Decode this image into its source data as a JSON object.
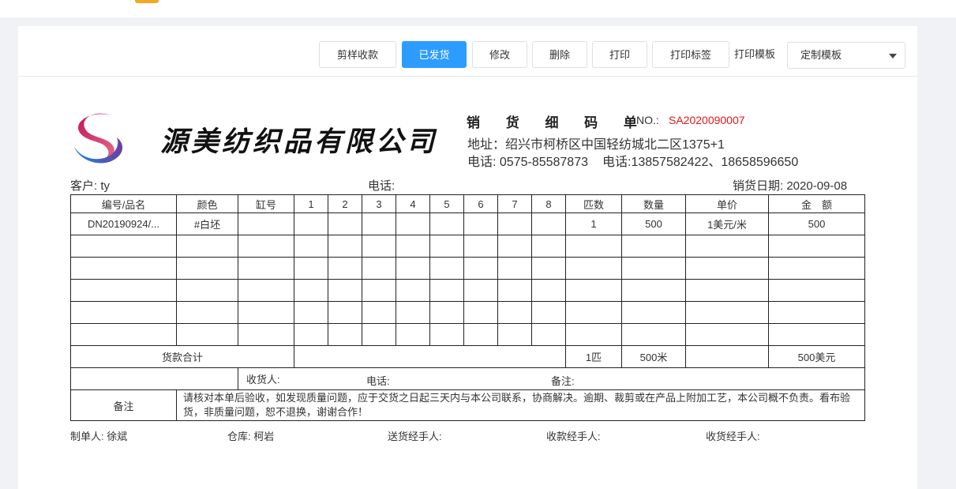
{
  "toolbar": {
    "buttons": [
      "剪样收款",
      "已发货",
      "修改",
      "删除",
      "打印",
      "打印标签"
    ],
    "template_label": "打印模板",
    "template_value": "定制模板"
  },
  "doc": {
    "company": "源美纺织品有限公司",
    "title": "销 货 细 码 单",
    "no_label": "NO.:",
    "no_value": "SA2020090007",
    "address": "地址：绍兴市柯桥区中国轻纺城北二区1375+1",
    "phone1": "电话: 0575-85587873",
    "phone2": "电话:13857582422、18658596650",
    "customer": "客户:  ty",
    "tel": "电话:",
    "date": "销货日期:  2020-09-08"
  },
  "table": {
    "headers": [
      "编号/品名",
      "颜色",
      "缸号",
      "1",
      "2",
      "3",
      "4",
      "5",
      "6",
      "7",
      "8",
      "匹数",
      "数量",
      "单价",
      "金　额"
    ],
    "row1": {
      "code": "DN20190924/...",
      "color": "#白坯",
      "pieces": "1",
      "qty": "500",
      "price": "1美元/米",
      "amount": "500"
    },
    "total": {
      "label": "货款合计",
      "pieces": "1匹",
      "qty": "500米",
      "amount": "500美元"
    },
    "receiver": {
      "receiver": "收货人:",
      "tel": "电话:",
      "remark": "备注:"
    },
    "note": {
      "label": "备注",
      "text": "请核对本单后验收，如发现质量问题，应于交货之日起三天内与本公司联系，协商解决。逾期、裁剪或在产品上附加工艺，本公司概不负责。看布验货，非质量问题，恕不退换，谢谢合作！"
    }
  },
  "footer": {
    "maker": "制单人:  徐斌",
    "warehouse": "仓库: 柯岩",
    "delivery": "送货经手人:",
    "payment": "收款经手人:",
    "receipt": "收货经手人:"
  }
}
